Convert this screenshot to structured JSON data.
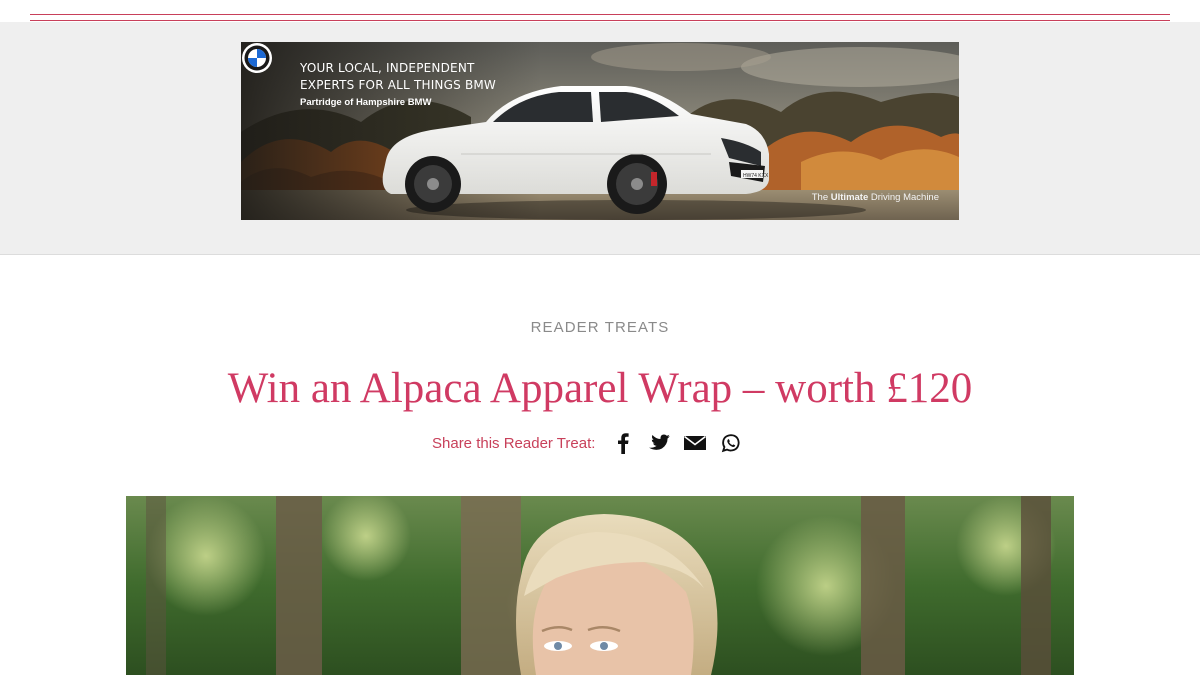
{
  "ad": {
    "headline_line1": "YOUR LOCAL, INDEPENDENT",
    "headline_line2": "EXPERTS FOR ALL THINGS BMW",
    "dealer": "Partridge of Hampshire BMW",
    "tagline_pre": "The ",
    "tagline_bold": "Ultimate",
    "tagline_post": " Driving Machine",
    "plate": "HW74 KXX",
    "logo_icon": "bmw-roundel-icon"
  },
  "article": {
    "category": "READER TREATS",
    "title": "Win an Alpaca Apparel Wrap – worth £120",
    "share_label": "Share this Reader Treat:",
    "share_icons": [
      "facebook-icon",
      "twitter-icon",
      "email-icon",
      "whatsapp-icon"
    ]
  },
  "colors": {
    "accent": "#d03a63",
    "rule": "#c8405a",
    "category": "#8a8a8a",
    "ad_band": "#efefef"
  }
}
